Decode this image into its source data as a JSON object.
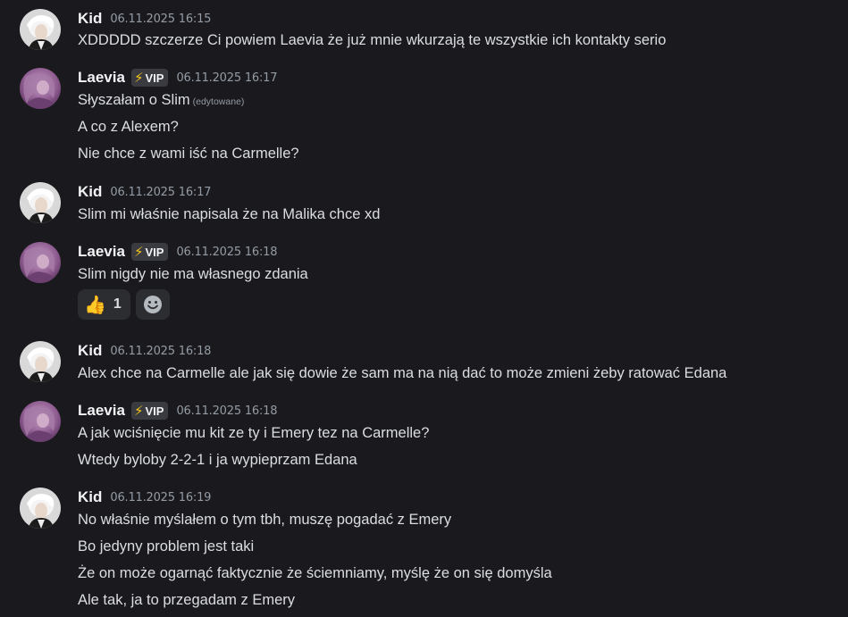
{
  "badge": {
    "label": "VIP",
    "icon": "lightning-bolt-icon",
    "color": "#f5c518"
  },
  "edited_label": "(edytowane)",
  "messages": [
    {
      "author": "Kid",
      "timestamp": "06.11.2025 16:15",
      "vip": false,
      "lines": [
        "XDDDDD szczerze Ci powiem Laevia że już mnie wkurzają te wszystkie ich kontakty serio"
      ]
    },
    {
      "author": "Laevia",
      "timestamp": "06.11.2025 16:17",
      "vip": true,
      "lines": [
        "Słyszałam o Slim",
        "A co z Alexem?",
        "Nie chce z wami iść na Carmelle?"
      ]
    },
    {
      "author": "Kid",
      "timestamp": "06.11.2025 16:17",
      "vip": false,
      "lines": [
        "Slim mi właśnie napisala że na Malika chce xd"
      ]
    },
    {
      "author": "Laevia",
      "timestamp": "06.11.2025 16:18",
      "vip": true,
      "lines": [
        "Slim nigdy nie ma własnego zdania"
      ],
      "reactions": [
        {
          "emoji": "👍",
          "icon": "thumbs-up-icon",
          "count": "1"
        }
      ],
      "add_reaction_icon": "add-reaction-smiley-icon"
    },
    {
      "author": "Kid",
      "timestamp": "06.11.2025 16:18",
      "vip": false,
      "lines": [
        "Alex chce na Carmelle ale jak się dowie że sam ma na nią dać to może zmieni żeby ratować Edana"
      ]
    },
    {
      "author": "Laevia",
      "timestamp": "06.11.2025 16:18",
      "vip": true,
      "lines": [
        "A jak wciśnięcie mu kit ze ty i Emery tez na Carmelle?",
        "Wtedy byloby 2-2-1 i ja wypieprzam Edana"
      ]
    },
    {
      "author": "Kid",
      "timestamp": "06.11.2025 16:19",
      "vip": false,
      "lines": [
        "No właśnie myślałem o tym tbh, muszę pogadać z Emery",
        "Bo jedyny problem jest taki",
        "Że on może ogarnąć faktycznie że ściemniamy, myślę że on się domyśla",
        "Ale tak, ja to przegadam z Emery"
      ]
    }
  ]
}
